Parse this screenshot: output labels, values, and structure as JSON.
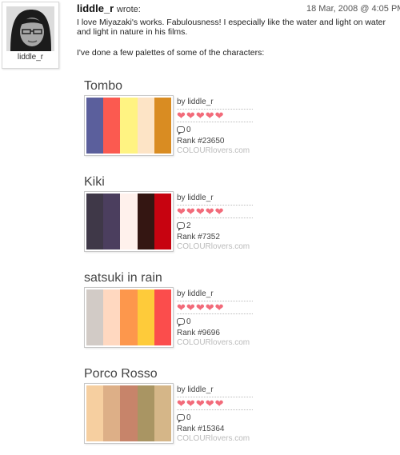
{
  "post": {
    "avatar_username": "liddle_r",
    "author": "liddle_r",
    "wrote": "wrote:",
    "date": "18 Mar, 2008 @ 4:05 PM",
    "message_lines": [
      "I love Miyazaki's works. Fabulousness! I especially like the water and light on water",
      "and light in nature in his films."
    ],
    "intro": "I've done a few palettes of some of the characters:"
  },
  "palettes": [
    {
      "title": "Tombo",
      "colors": [
        "#5b5f9c",
        "#fb5a50",
        "#fff382",
        "#fde4c6",
        "#d98c22"
      ],
      "by": "by liddle_r",
      "hearts": 5,
      "comments": "0",
      "rank": "Rank  #23650",
      "brand": "COLOURlovers.com"
    },
    {
      "title": "Kiki",
      "colors": [
        "#3f3848",
        "#4b3e5e",
        "#fff1ec",
        "#341612",
        "#c70310"
      ],
      "by": "by liddle_r",
      "hearts": 5,
      "comments": "2",
      "rank": "Rank  #7352",
      "brand": "COLOURlovers.com"
    },
    {
      "title": "satsuki in rain",
      "colors": [
        "#d2cbc6",
        "#ffd8c0",
        "#fd974c",
        "#fecb3a",
        "#fb4d4c"
      ],
      "by": "by liddle_r",
      "hearts": 5,
      "comments": "0",
      "rank": "Rank  #9696",
      "brand": "COLOURlovers.com"
    },
    {
      "title": "Porco Rosso",
      "colors": [
        "#f6cfa0",
        "#ddaf87",
        "#c7846a",
        "#a99563",
        "#d5b688"
      ],
      "by": "by liddle_r",
      "hearts": 5,
      "comments": "0",
      "rank": "Rank  #15364",
      "brand": "COLOURlovers.com"
    }
  ]
}
